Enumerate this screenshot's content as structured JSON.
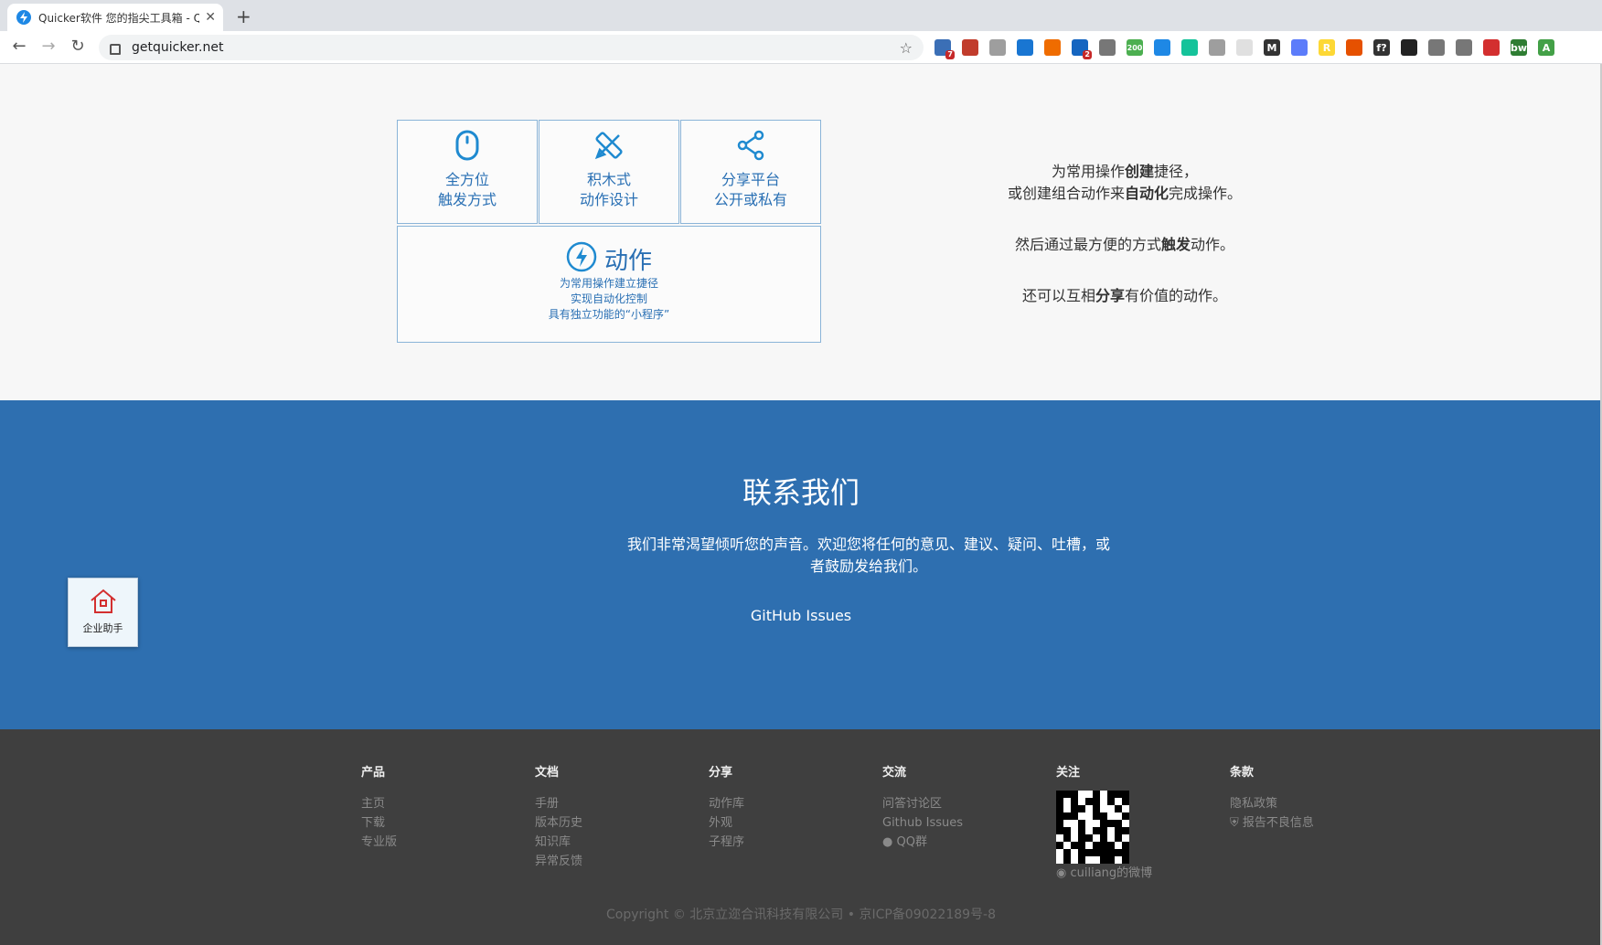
{
  "browser": {
    "tab_title": "Quicker软件 您的指尖工具箱 - Q",
    "new_tab": "+",
    "url": "getquicker.net",
    "extensions": [
      {
        "icon": "grid-icon",
        "color": "#3b6fb6",
        "badge": "7",
        "text": ""
      },
      {
        "icon": "dots-icon",
        "color": "#c13c2c",
        "badge": "",
        "text": ""
      },
      {
        "icon": "circle-icon",
        "color": "#9e9e9e",
        "badge": "",
        "text": ""
      },
      {
        "icon": "window-icon",
        "color": "#1976d2",
        "badge": "",
        "text": ""
      },
      {
        "icon": "chart-icon",
        "color": "#ef6c00",
        "badge": "",
        "text": ""
      },
      {
        "icon": "puzzle-icon",
        "color": "#1565c0",
        "badge": "2",
        "text": ""
      },
      {
        "icon": "gear-icon",
        "color": "#777",
        "badge": "",
        "text": ""
      },
      {
        "icon": "counter-icon",
        "color": "#4caf50",
        "badge": "",
        "text": "200"
      },
      {
        "icon": "check-icon",
        "color": "#1e88e5",
        "badge": "",
        "text": ""
      },
      {
        "icon": "grammarly-icon",
        "color": "#15c39a",
        "badge": "",
        "text": ""
      },
      {
        "icon": "code-icon",
        "color": "#9e9e9e",
        "badge": "",
        "text": ""
      },
      {
        "icon": "spark-icon",
        "color": "#e0e0e0",
        "badge": "",
        "text": ""
      },
      {
        "icon": "m-icon",
        "color": "#333",
        "badge": "",
        "text": "M"
      },
      {
        "icon": "link-icon",
        "color": "#5c7cfa",
        "badge": "",
        "text": ""
      },
      {
        "icon": "r-icon",
        "color": "#fdd835",
        "badge": "",
        "text": "R"
      },
      {
        "icon": "wordpress-icon",
        "color": "#e65100",
        "badge": "",
        "text": ""
      },
      {
        "icon": "formula-icon",
        "color": "#333",
        "badge": "",
        "text": "f?"
      },
      {
        "icon": "ghost-icon",
        "color": "#222",
        "badge": "",
        "text": ""
      },
      {
        "icon": "tag-icon",
        "color": "#777",
        "badge": "",
        "text": ""
      },
      {
        "icon": "photo-icon",
        "color": "#777",
        "badge": "",
        "text": ""
      },
      {
        "icon": "s-icon",
        "color": "#d32f2f",
        "badge": "",
        "text": ""
      },
      {
        "icon": "bw-icon",
        "color": "#2e7d32",
        "badge": "",
        "text": "bw"
      },
      {
        "icon": "a-icon",
        "color": "#43a047",
        "badge": "",
        "text": "A"
      }
    ]
  },
  "features": {
    "boxes": [
      {
        "l1": "全方位",
        "l2": "触发方式"
      },
      {
        "l1": "积木式",
        "l2": "动作设计"
      },
      {
        "l1": "分享平台",
        "l2": "公开或私有"
      }
    ],
    "action": {
      "title": "动作",
      "lines": [
        "为常用操作建立捷径",
        "实现自动化控制",
        "具有独立功能的“小程序”"
      ]
    },
    "desc": {
      "p1_a": "为常用操作",
      "p1_b": "创建",
      "p1_c": "捷径，",
      "p2_a": "或创建组合动作来",
      "p2_b": "自动化",
      "p2_c": "完成操作。",
      "p3_a": "然后通过最方便的方式",
      "p3_b": "触发",
      "p3_c": "动作。",
      "p4_a": "还可以互相",
      "p4_b": "分享",
      "p4_c": "有价值的动作。"
    }
  },
  "contact": {
    "title": "联系我们",
    "text": "我们非常渴望倾听您的声音。欢迎您将任何的意见、建议、疑问、吐槽，或者鼓励发给我们。",
    "link": "GitHub Issues"
  },
  "footer": {
    "columns": [
      {
        "head": "产品",
        "items": [
          "主页",
          "下载",
          "专业版"
        ]
      },
      {
        "head": "文档",
        "items": [
          "手册",
          "版本历史",
          "知识库",
          "异常反馈"
        ]
      },
      {
        "head": "分享",
        "items": [
          "动作库",
          "外观",
          "子程序"
        ]
      },
      {
        "head": "交流",
        "items": [
          "问答讨论区",
          "Github Issues",
          "QQ群"
        ]
      },
      {
        "head": "关注",
        "weibo": "cuiliang的微博"
      },
      {
        "head": "条款",
        "items": [
          "隐私政策",
          "报告不良信息"
        ]
      }
    ],
    "copyright": "Copyright © 北京立迩合讯科技有限公司 • 京ICP备09022189号-8"
  },
  "assistant": {
    "label": "企业助手"
  }
}
